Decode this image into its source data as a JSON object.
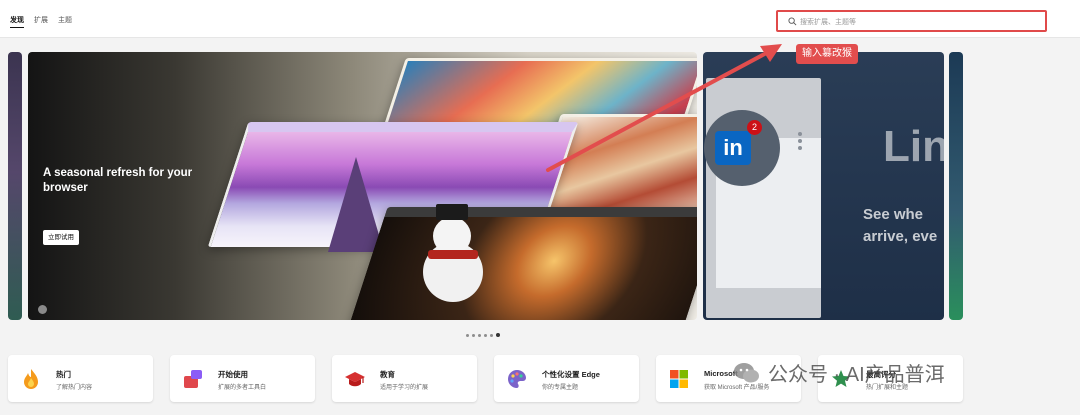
{
  "topbar": {
    "tabs": [
      {
        "label": "发现",
        "active": true
      },
      {
        "label": "扩展",
        "active": false
      },
      {
        "label": "主题",
        "active": false
      }
    ],
    "search": {
      "placeholder": "搜索扩展、主题等"
    }
  },
  "annotation": {
    "text": "输入篡改猴",
    "color": "#e24d4d"
  },
  "hero": {
    "title": "A seasonal refresh for your browser",
    "button_label": "立即试用"
  },
  "linkedin_card": {
    "logo_text": "in",
    "badge": "2",
    "big_text": "Lin",
    "sub_line_1": "See whe",
    "sub_line_2": "arrive, eve"
  },
  "carousel": {
    "dot_count": 6,
    "active_index": 5
  },
  "categories": [
    {
      "title": "热门",
      "subtitle": "了解热门内容",
      "icon": "flame-icon"
    },
    {
      "title": "开始使用",
      "subtitle": "扩展的多者工具白",
      "icon": "getting-started-icon"
    },
    {
      "title": "教育",
      "subtitle": "适用于学习的扩展",
      "icon": "graduation-cap-icon"
    },
    {
      "title": "个性化设置 Edge",
      "subtitle": "你的专属主题",
      "icon": "palette-icon"
    },
    {
      "title": "Microsoft",
      "subtitle": "获取 Microsoft 产品/服务",
      "icon": "microsoft-logo-icon"
    },
    {
      "title": "最高评分",
      "subtitle": "热门扩展和主题",
      "icon": "top-rated-icon"
    }
  ],
  "watermark": {
    "text": "公众号 · AI产品普洱"
  },
  "colors": {
    "accent": "#e24d4d",
    "linkedin": "#0a66c2"
  }
}
